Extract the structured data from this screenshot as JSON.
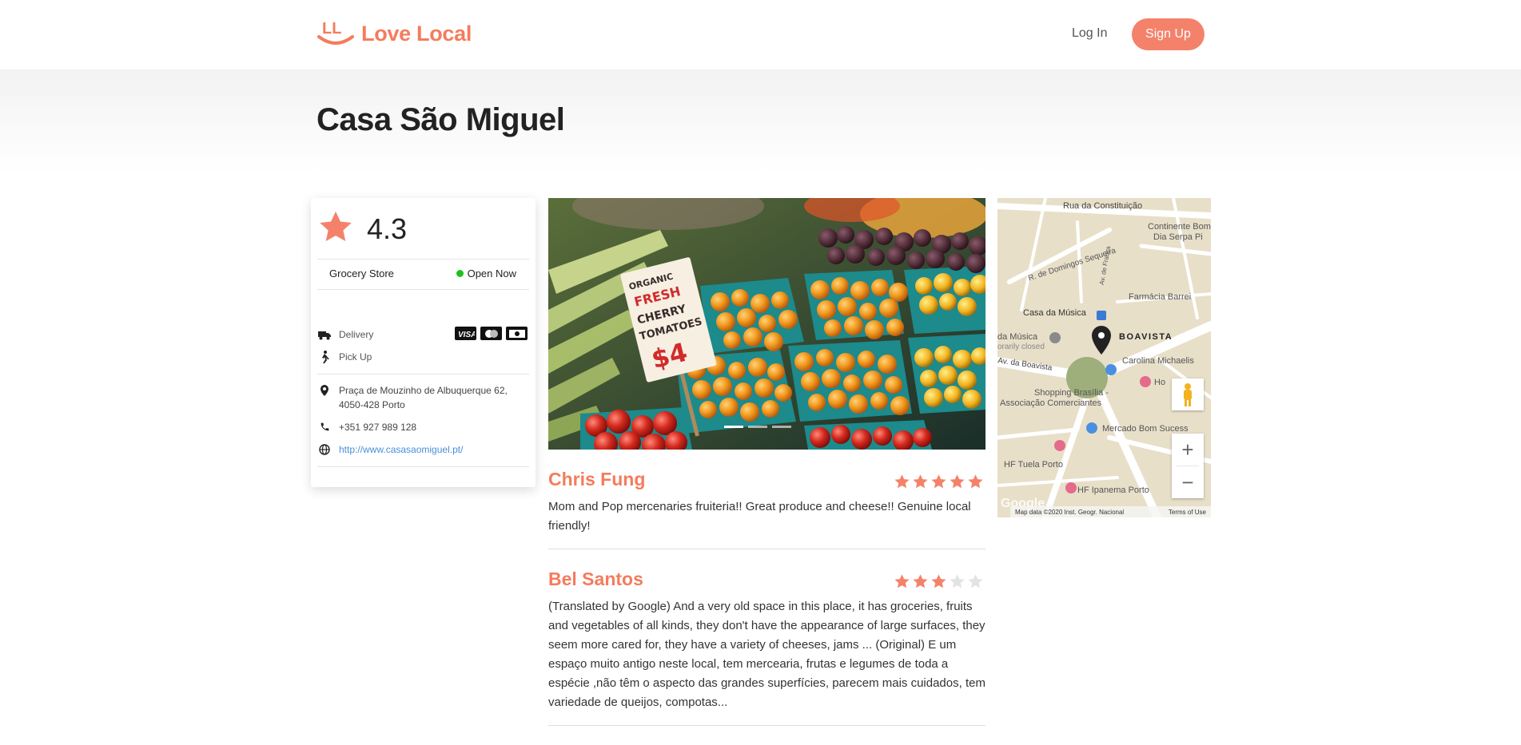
{
  "header": {
    "logo_mark": "LL",
    "logo_text": "Love Local",
    "login_label": "Log In",
    "signup_label": "Sign Up"
  },
  "store": {
    "name": "Casa São Miguel",
    "rating": "4.3",
    "category": "Grocery Store",
    "status": "Open Now",
    "services": [
      "Delivery",
      "Pick Up"
    ],
    "payment_methods": [
      "visa-card-icon",
      "mastercard-icon",
      "cash-icon"
    ],
    "address": "Praça de Mouzinho de Albuquerque 62, 4050-428 Porto",
    "phone": "+351 927 989 128",
    "website": "http://www.casasaomiguel.pt/"
  },
  "carousel": {
    "slide_count": 3,
    "active_index": 0
  },
  "reviews": [
    {
      "author": "Chris Fung",
      "stars": 5,
      "text": "Mom and Pop mercenaries fruiteria!! Great produce and cheese!! Genuine local friendly!"
    },
    {
      "author": "Bel Santos",
      "stars": 3,
      "text": "(Translated by Google) And a very old space in this place, it has groceries, fruits and vegetables of all kinds, they don't have the appearance of large surfaces, they seem more cared for, they have a variety of cheeses, jams ... (Original) E um espaço muito antigo neste local, tem mercearia, frutas e legumes de toda a espécie ,não têm o aspecto das grandes superfícies, parecem mais cuidados, tem variedade de queijos, compotas..."
    }
  ],
  "map": {
    "labels": {
      "street_1": "Rua da Constituição",
      "street_2": "R. de Domingos Sequeira",
      "street_3": "Av. de França",
      "poi_1": "Continente Bom",
      "poi_1b": "Dia Serpa Pi",
      "poi_2": "Farmácia Barrei",
      "poi_3": "Casa da Música",
      "poi_3b": "da Música",
      "poi_3c": "orarily closed",
      "district": "BOAVISTA",
      "street_4": "Av. da Boavista",
      "poi_4": "Carolina Michaelis",
      "poi_5": "Shopping Brasília -",
      "poi_5b": "Associação Comerciantes",
      "poi_6": "Ho",
      "poi_7": "Mercado Bom Sucess",
      "poi_8": "HF Tuela Porto",
      "poi_9": "HF Ipanema Porto",
      "google": "Google",
      "attribution": "Map data ©2020 Inst. Geogr. Nacional",
      "terms": "Terms of Use"
    },
    "colors": {
      "land": "#e8dfc9",
      "road": "#ffffff",
      "park": "#9eaf7b",
      "accent": "#f4826a"
    }
  }
}
